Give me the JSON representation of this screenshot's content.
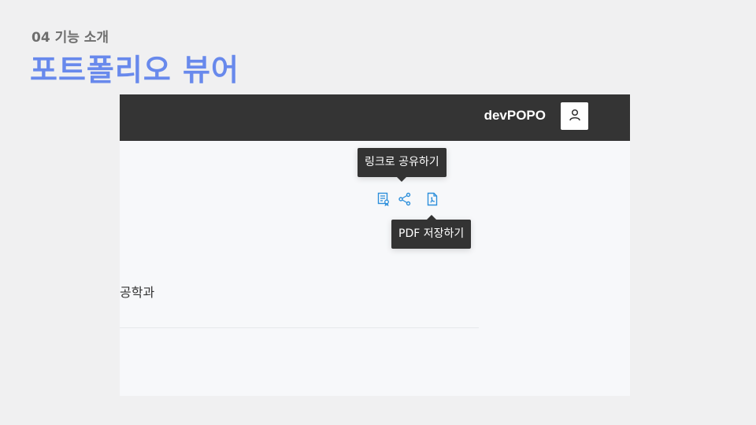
{
  "slide": {
    "subtitle": "04 기능 소개",
    "title": "포트폴리오 뷰어"
  },
  "header": {
    "username": "devPOPO",
    "user_icon": "user-icon"
  },
  "toolbar": {
    "icons": [
      "certificate-icon",
      "share-icon",
      "pdf-icon"
    ],
    "accent_color": "#2d8fdb",
    "share_tooltip": "링크로 공유하기",
    "pdf_tooltip": "PDF 저장하기"
  },
  "content": {
    "department_partial": "공학과"
  }
}
